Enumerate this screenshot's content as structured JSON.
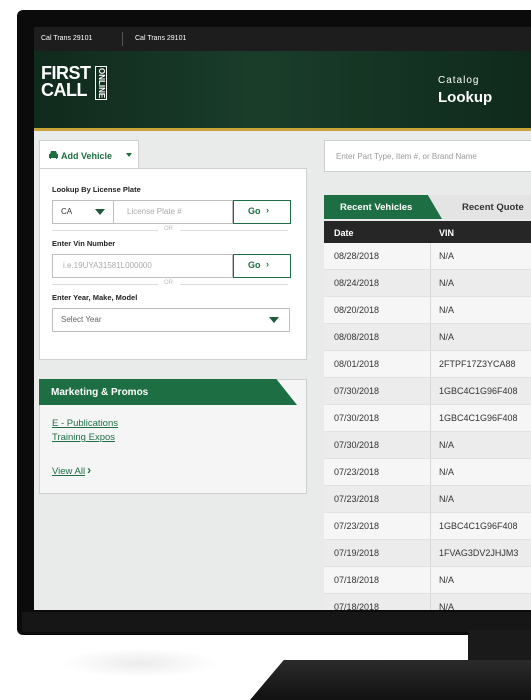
{
  "topbar": {
    "account_1": "Cal Trans 29101",
    "account_2": "Cal Trans 29101"
  },
  "logo": {
    "line1": "FIRST",
    "line2": "CALL",
    "vertical": "ONLINE"
  },
  "header": {
    "catalog": "Catalog",
    "lookup": "Lookup"
  },
  "vehicle": {
    "add_label": "Add Vehicle",
    "plate_label": "Lookup By License Plate",
    "state": "CA",
    "plate_placeholder": "License Plate #",
    "go_label": "Go",
    "or_text": "OR",
    "vin_label": "Enter Vin Number",
    "vin_placeholder": "i.e.19UYA31581L000000",
    "ymm_label": "Enter Year, Make, Model",
    "year_placeholder": "Select Year"
  },
  "marketing": {
    "title": "Marketing & Promos",
    "links": [
      "E - Publications",
      "Training Expos"
    ],
    "view_all": "View All"
  },
  "search": {
    "placeholder": "Enter Part Type, Item #, or Brand Name"
  },
  "tabs": {
    "recent_vehicles": "Recent Vehicles",
    "recent_quotes": "Recent Quote"
  },
  "table": {
    "headers": [
      "Date",
      "VIN"
    ],
    "rows": [
      {
        "date": "08/28/2018",
        "vin": "N/A"
      },
      {
        "date": "08/24/2018",
        "vin": "N/A"
      },
      {
        "date": "08/20/2018",
        "vin": "N/A"
      },
      {
        "date": "08/08/2018",
        "vin": "N/A"
      },
      {
        "date": "08/01/2018",
        "vin": "2FTPF17Z3YCA88"
      },
      {
        "date": "07/30/2018",
        "vin": "1GBC4C1G96F408"
      },
      {
        "date": "07/30/2018",
        "vin": "1GBC4C1G96F408"
      },
      {
        "date": "07/30/2018",
        "vin": "N/A"
      },
      {
        "date": "07/23/2018",
        "vin": "N/A"
      },
      {
        "date": "07/23/2018",
        "vin": "N/A"
      },
      {
        "date": "07/23/2018",
        "vin": "1GBC4C1G96F408"
      },
      {
        "date": "07/19/2018",
        "vin": "1FVAG3DV2JHJM3"
      },
      {
        "date": "07/18/2018",
        "vin": "N/A"
      },
      {
        "date": "07/18/2018",
        "vin": "N/A"
      }
    ]
  },
  "colors": {
    "brand_green": "#1e6e43",
    "header_dark": "#102a1c",
    "gold": "#c9a43a"
  }
}
